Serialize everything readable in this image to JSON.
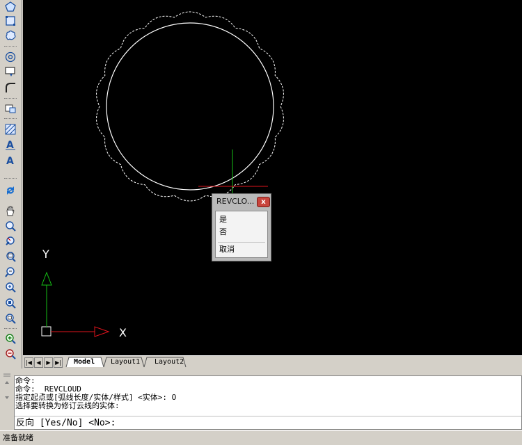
{
  "toolbar": {
    "icons": [
      "polygon-icon",
      "rectangle-icon",
      "revcloud-icon",
      "donut-icon",
      "wipeout-icon",
      "fillet-icon",
      "insert-block-icon",
      "hatch-icon",
      "text-icon",
      "mtext-icon",
      "regen-icon",
      "pan-icon",
      "zoom-realtime-icon",
      "zoom-previous-icon",
      "zoom-window-icon",
      "zoom-dynamic-icon",
      "zoom-scale-icon",
      "zoom-center-icon",
      "zoom-object-icon",
      "zoom-in-icon",
      "zoom-out-icon"
    ]
  },
  "canvas": {
    "background": "#000000",
    "ucs": {
      "y_label": "Y",
      "x_label": "X",
      "x_color": "#e0141c",
      "y_color": "#16c116"
    }
  },
  "tabs": {
    "items": [
      {
        "label": "Model",
        "active": true
      },
      {
        "label": "Layout1",
        "active": false
      },
      {
        "label": "Layout2",
        "active": false
      }
    ]
  },
  "command": {
    "history": [
      "命令:",
      "命令: _REVCLOUD",
      "指定起点或[弧线长度/实体/样式] <实体>: O",
      "选择要转换为修订云线的实体:"
    ],
    "prompt": "反向 [Yes/No] <No>:"
  },
  "status": {
    "text": "准备就绪"
  },
  "popup": {
    "title": "REVCLO...",
    "close_label": "x",
    "items": [
      "是",
      "否",
      "取消"
    ]
  }
}
